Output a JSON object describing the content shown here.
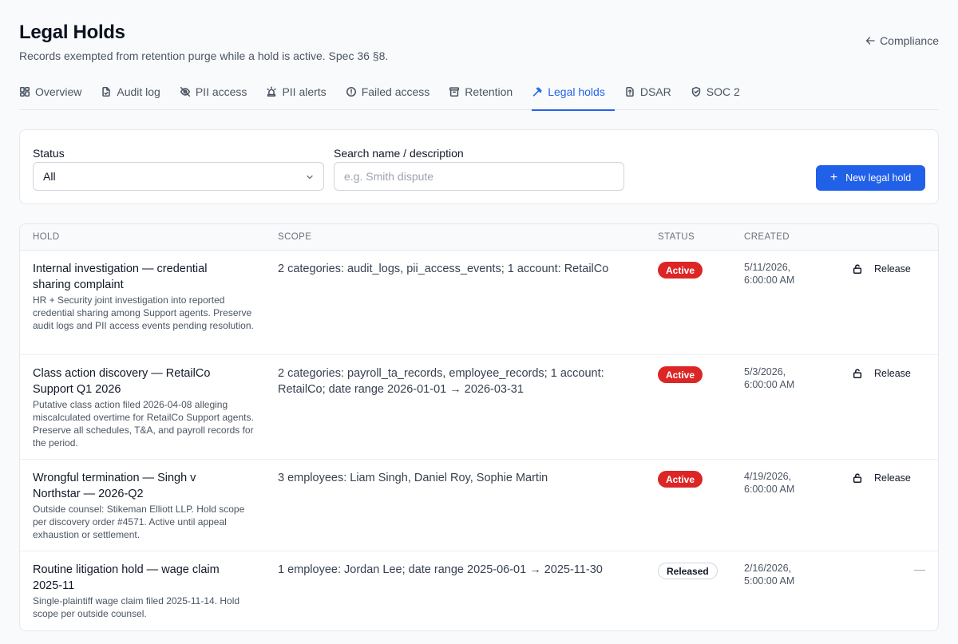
{
  "header": {
    "title": "Legal Holds",
    "subtitle": "Records exempted from retention purge while a hold is active. Spec 36 §8.",
    "back_link": "Compliance"
  },
  "tabs": [
    {
      "label": "Overview",
      "icon": "grid-icon"
    },
    {
      "label": "Audit log",
      "icon": "file-icon"
    },
    {
      "label": "PII access",
      "icon": "eye-off-icon"
    },
    {
      "label": "PII alerts",
      "icon": "siren-icon"
    },
    {
      "label": "Failed access",
      "icon": "alert-circle-icon"
    },
    {
      "label": "Retention",
      "icon": "archive-icon"
    },
    {
      "label": "Legal holds",
      "icon": "gavel-icon",
      "active": true
    },
    {
      "label": "DSAR",
      "icon": "file-question-icon"
    },
    {
      "label": "SOC 2",
      "icon": "shield-icon"
    }
  ],
  "filters": {
    "status_label": "Status",
    "status_value": "All",
    "search_label": "Search name / description",
    "search_placeholder": "e.g. Smith dispute",
    "search_value": "",
    "new_button": "New legal hold"
  },
  "table": {
    "columns": [
      "HOLD",
      "SCOPE",
      "STATUS",
      "CREATED"
    ],
    "rows": [
      {
        "name": "Internal investigation — credential sharing complaint",
        "description": "HR + Security joint investigation into reported credential sharing among Support agents. Preserve audit logs and PII access events pending resolution.",
        "scope": "2 categories: audit_logs, pii_access_events; 1 account: RetailCo",
        "status": "Active",
        "created_date": "5/11/2026,",
        "created_time": "6:00:00 AM",
        "action": "Release"
      },
      {
        "name": "Class action discovery — RetailCo Support Q1 2026",
        "description": "Putative class action filed 2026-04-08 alleging miscalculated overtime for RetailCo Support agents. Preserve all schedules, T&A, and payroll records for the period.",
        "scope": "2 categories: payroll_ta_records, employee_records; 1 account: RetailCo; date range 2026-01-01 → 2026-03-31",
        "status": "Active",
        "created_date": "5/3/2026,",
        "created_time": "6:00:00 AM",
        "action": "Release"
      },
      {
        "name": "Wrongful termination — Singh v Northstar — 2026-Q2",
        "description": "Outside counsel: Stikeman Elliott LLP. Hold scope per discovery order #4571. Active until appeal exhaustion or settlement.",
        "scope": "3 employees: Liam Singh, Daniel Roy, Sophie Martin",
        "status": "Active",
        "created_date": "4/19/2026,",
        "created_time": "6:00:00 AM",
        "action": "Release"
      },
      {
        "name": "Routine litigation hold — wage claim 2025-11",
        "description": "Single-plaintiff wage claim filed 2025-11-14. Hold scope per outside counsel.",
        "scope": "1 employee: Jordan Lee; date range 2025-06-01 → 2025-11-30",
        "status": "Released",
        "created_date": "2/16/2026,",
        "created_time": "5:00:00 AM",
        "action": "—"
      }
    ]
  }
}
